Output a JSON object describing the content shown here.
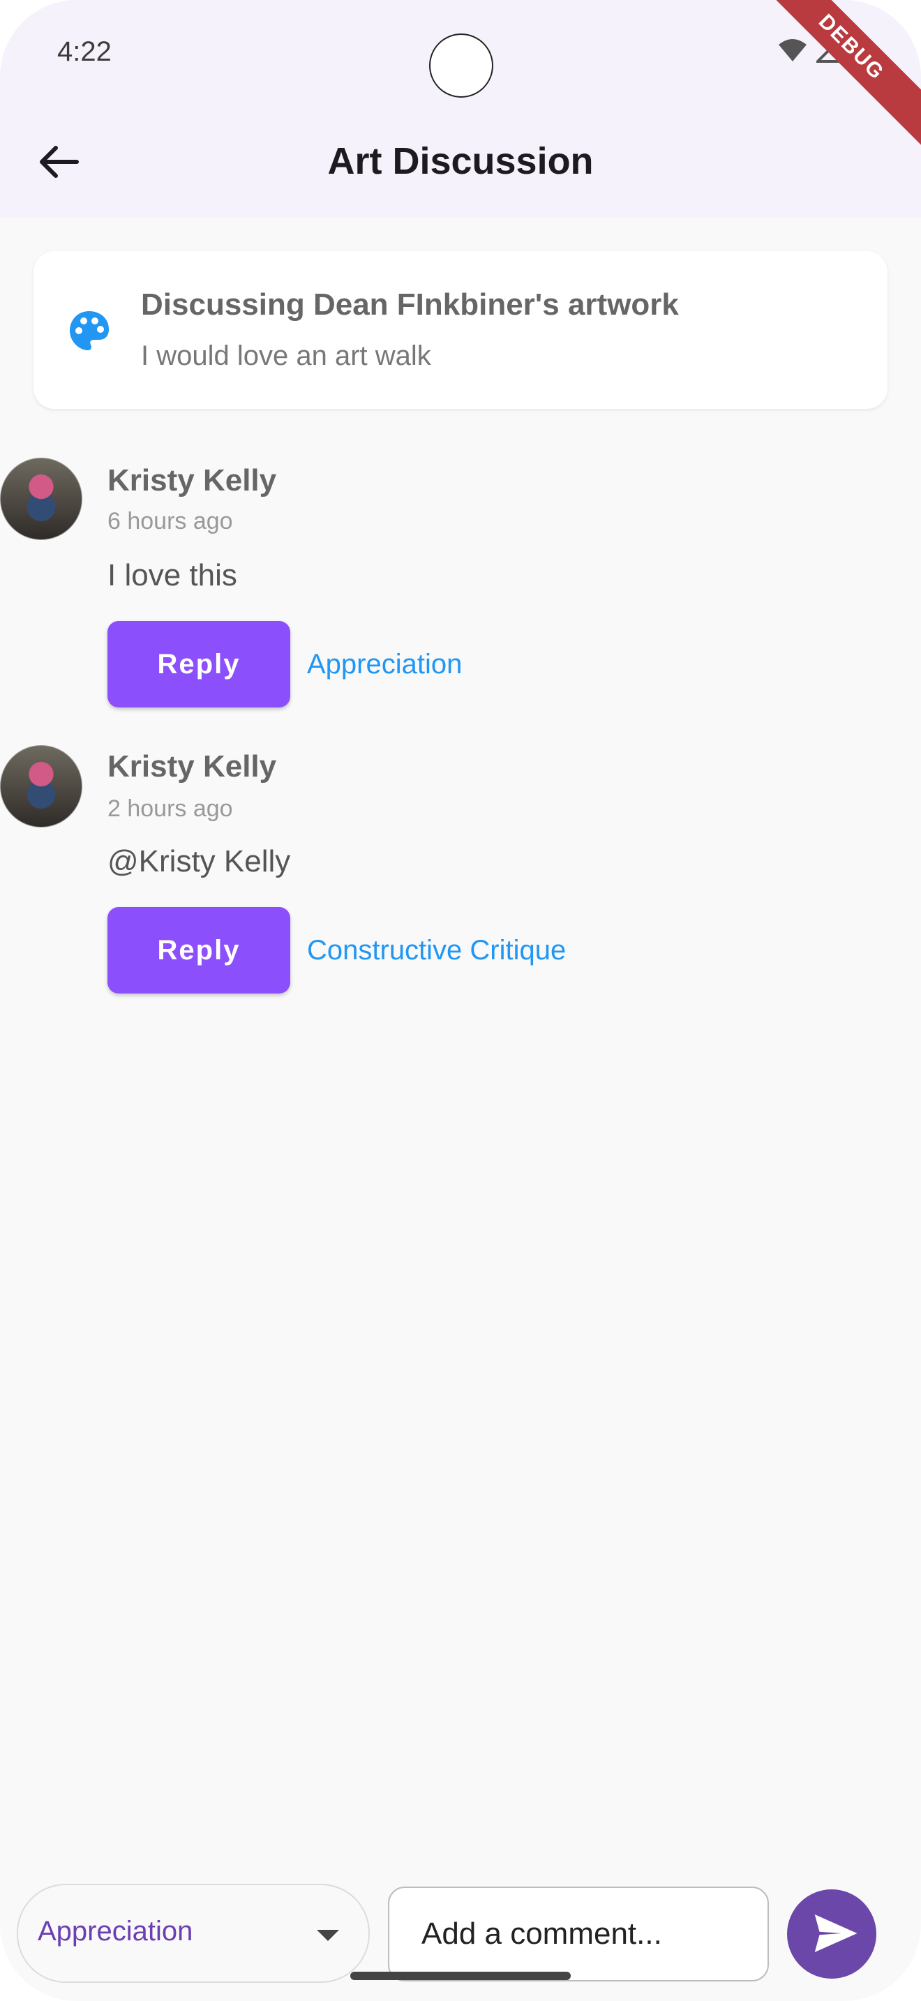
{
  "status": {
    "time": "4:22",
    "debug_label": "DEBUG"
  },
  "appbar": {
    "title": "Art Discussion",
    "back_icon": "arrow-back-icon"
  },
  "header_card": {
    "icon": "palette-icon",
    "icon_color": "#2196f3",
    "title": "Discussing Dean FInkbiner's artwork",
    "subtitle": "I would love an art walk"
  },
  "comments": [
    {
      "author": "Kristy Kelly",
      "time": "6 hours ago",
      "text": "I love this",
      "reply_label": "Reply",
      "tag": "Appreciation"
    },
    {
      "author": "Kristy Kelly",
      "time": "2 hours ago",
      "text": "@Kristy Kelly",
      "reply_label": "Reply",
      "tag": "Constructive Critique"
    }
  ],
  "composer": {
    "category_selected": "Appreciation",
    "input_placeholder": "Add a comment...",
    "send_icon": "send-icon"
  },
  "colors": {
    "accent": "#8b4ffc",
    "tag": "#2196f3",
    "send": "#6a47a8"
  }
}
